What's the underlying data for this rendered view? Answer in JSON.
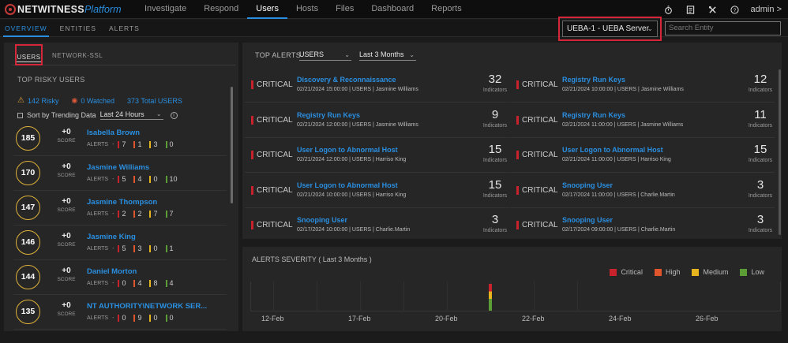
{
  "app": {
    "brand_main": "NETWITNESS",
    "brand_sub": "Platform"
  },
  "nav": [
    {
      "label": "Investigate"
    },
    {
      "label": "Respond"
    },
    {
      "label": "Users",
      "active": true
    },
    {
      "label": "Hosts"
    },
    {
      "label": "Files"
    },
    {
      "label": "Dashboard"
    },
    {
      "label": "Reports"
    }
  ],
  "header_icons": [
    "timer-icon",
    "notes-icon",
    "tools-icon",
    "help-icon"
  ],
  "user": {
    "name": "admin",
    "chevron": ">"
  },
  "subtabs": [
    {
      "label": "OVERVIEW",
      "active": true
    },
    {
      "label": "ENTITIES"
    },
    {
      "label": "ALERTS"
    }
  ],
  "server_select": {
    "value": "UEBA-1 - UEBA Server"
  },
  "search": {
    "placeholder": "Search Entity"
  },
  "left": {
    "tabs": [
      "USERS",
      "NETWORK-SSL"
    ],
    "title": "TOP RISKY USERS",
    "risky": "142 Risky",
    "watched": "0 Watched",
    "total": "373 Total USERS",
    "sort_label": "Sort by Trending Data",
    "sort_value": "Last 24 Hours",
    "score_label": "SCORE",
    "alerts_label": "ALERTS",
    "dash": "-",
    "users": [
      {
        "score": "185",
        "delta": "+0",
        "name": "Isabella Brown",
        "c": "7",
        "h": "1",
        "m": "3",
        "l": "0"
      },
      {
        "score": "170",
        "delta": "+0",
        "name": "Jasmine Williams",
        "c": "5",
        "h": "4",
        "m": "0",
        "l": "10"
      },
      {
        "score": "147",
        "delta": "+0",
        "name": "Jasmine Thompson",
        "c": "2",
        "h": "2",
        "m": "7",
        "l": "7"
      },
      {
        "score": "146",
        "delta": "+0",
        "name": "Jasmine King",
        "c": "5",
        "h": "3",
        "m": "0",
        "l": "1"
      },
      {
        "score": "144",
        "delta": "+0",
        "name": "Daniel Morton",
        "c": "0",
        "h": "4",
        "m": "8",
        "l": "4"
      },
      {
        "score": "135",
        "delta": "+0",
        "name": "NT AUTHORITY\\NETWORK SER...",
        "c": "0",
        "h": "9",
        "m": "0",
        "l": "0"
      }
    ]
  },
  "top_alerts": {
    "title": "TOP ALERTS",
    "entity_filter": "USERS",
    "time_filter": "Last 3 Months",
    "indicators_label": "Indicators",
    "severity": "CRITICAL",
    "left": [
      {
        "name": "Discovery & Reconnaissance",
        "meta": "02/21/2024 15:00:00  |  USERS  |  Jasmine Williams",
        "count": "32"
      },
      {
        "name": "Registry Run Keys",
        "meta": "02/21/2024 12:00:00  |  USERS  |  Jasmine Williams",
        "count": "9"
      },
      {
        "name": "User Logon to Abnormal Host",
        "meta": "02/21/2024 12:00:00  |  USERS  |  Harriso King",
        "count": "15"
      },
      {
        "name": "User Logon to Abnormal Host",
        "meta": "02/21/2024 10:00:00  |  USERS  |  Harriso King",
        "count": "15"
      },
      {
        "name": "Snooping User",
        "meta": "02/17/2024 10:00:00  |  USERS  |  Charlie.Martin",
        "count": "3"
      }
    ],
    "right": [
      {
        "name": "Registry Run Keys",
        "meta": "02/21/2024 10:00:00  |  USERS  |  Jasmine Williams",
        "count": "12"
      },
      {
        "name": "Registry Run Keys",
        "meta": "02/21/2024 11:00:00  |  USERS  |  Jasmine Williams",
        "count": "11"
      },
      {
        "name": "User Logon to Abnormal Host",
        "meta": "02/21/2024 11:00:00  |  USERS  |  Harriso King",
        "count": "15"
      },
      {
        "name": "Snooping User",
        "meta": "02/17/2024 11:00:00  |  USERS  |  Charlie.Martin",
        "count": "3"
      },
      {
        "name": "Snooping User",
        "meta": "02/17/2024 09:00:00  |  USERS  |  Charlie.Martin",
        "count": "3"
      }
    ]
  },
  "severity_chart": {
    "title": "ALERTS SEVERITY ( Last 3 Months )",
    "legend": [
      {
        "label": "Critical",
        "color": "#c8232c"
      },
      {
        "label": "High",
        "color": "#e0552b"
      },
      {
        "label": "Medium",
        "color": "#e6b41e"
      },
      {
        "label": "Low",
        "color": "#5a9e35"
      }
    ]
  },
  "chart_data": {
    "type": "bar",
    "title": "ALERTS SEVERITY ( Last 3 Months )",
    "x_tick_labels": [
      "12-Feb",
      "17-Feb",
      "20-Feb",
      "22-Feb",
      "24-Feb",
      "26-Feb"
    ],
    "series": [
      {
        "name": "Critical",
        "color": "#c8232c"
      },
      {
        "name": "High",
        "color": "#e0552b"
      },
      {
        "name": "Medium",
        "color": "#e6b41e"
      },
      {
        "name": "Low",
        "color": "#5a9e35"
      }
    ],
    "stacked_bars": [
      {
        "x": "21-Feb",
        "Critical": 0.25,
        "High": 0.05,
        "Medium": 0.25,
        "Low": 0.45
      }
    ]
  }
}
